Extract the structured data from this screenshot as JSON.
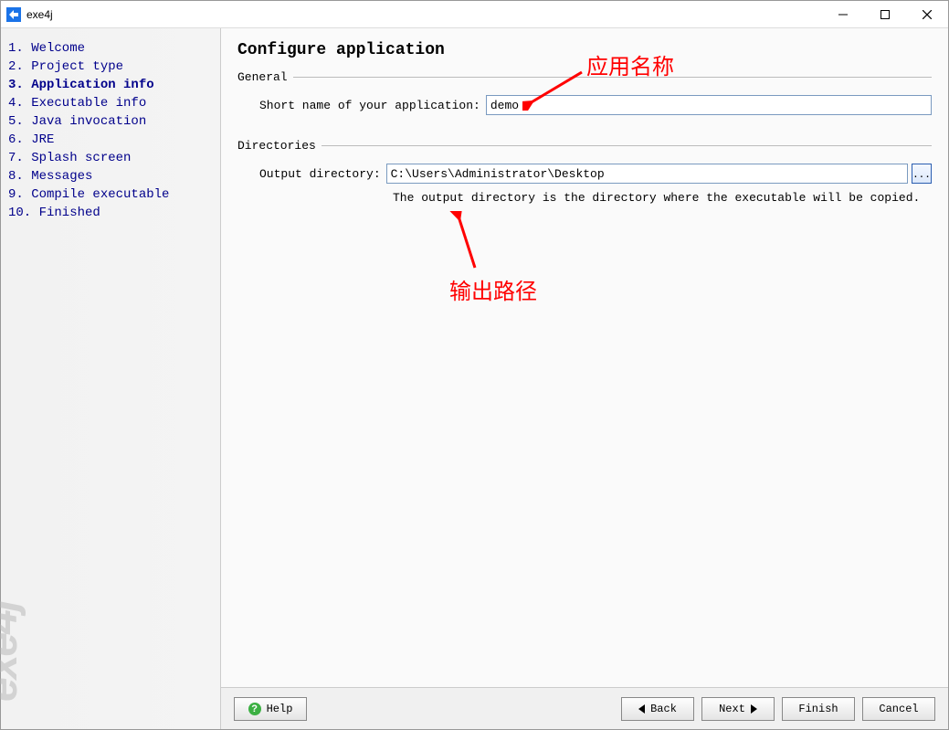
{
  "window": {
    "title": "exe4j"
  },
  "sidebar": {
    "items": [
      {
        "num": "1.",
        "label": "Welcome"
      },
      {
        "num": "2.",
        "label": "Project type"
      },
      {
        "num": "3.",
        "label": "Application info",
        "current": true
      },
      {
        "num": "4.",
        "label": "Executable info"
      },
      {
        "num": "5.",
        "label": "Java invocation"
      },
      {
        "num": "6.",
        "label": "JRE"
      },
      {
        "num": "7.",
        "label": "Splash screen"
      },
      {
        "num": "8.",
        "label": "Messages"
      },
      {
        "num": "9.",
        "label": "Compile executable"
      },
      {
        "num": "10.",
        "label": "Finished"
      }
    ],
    "watermark": "exe4j"
  },
  "page": {
    "title": "Configure application",
    "general": {
      "legend": "General",
      "short_name_label": "Short name of your application:",
      "short_name_value": "demo"
    },
    "directories": {
      "legend": "Directories",
      "output_label": "Output directory:",
      "output_value": "C:\\Users\\Administrator\\Desktop",
      "browse_label": "...",
      "hint": "The output directory is the directory where the executable will be copied."
    }
  },
  "annotations": {
    "app_name_label": "应用名称",
    "output_path_label": "输出路径"
  },
  "buttons": {
    "help": "Help",
    "back": "Back",
    "next": "Next",
    "finish": "Finish",
    "cancel": "Cancel"
  }
}
